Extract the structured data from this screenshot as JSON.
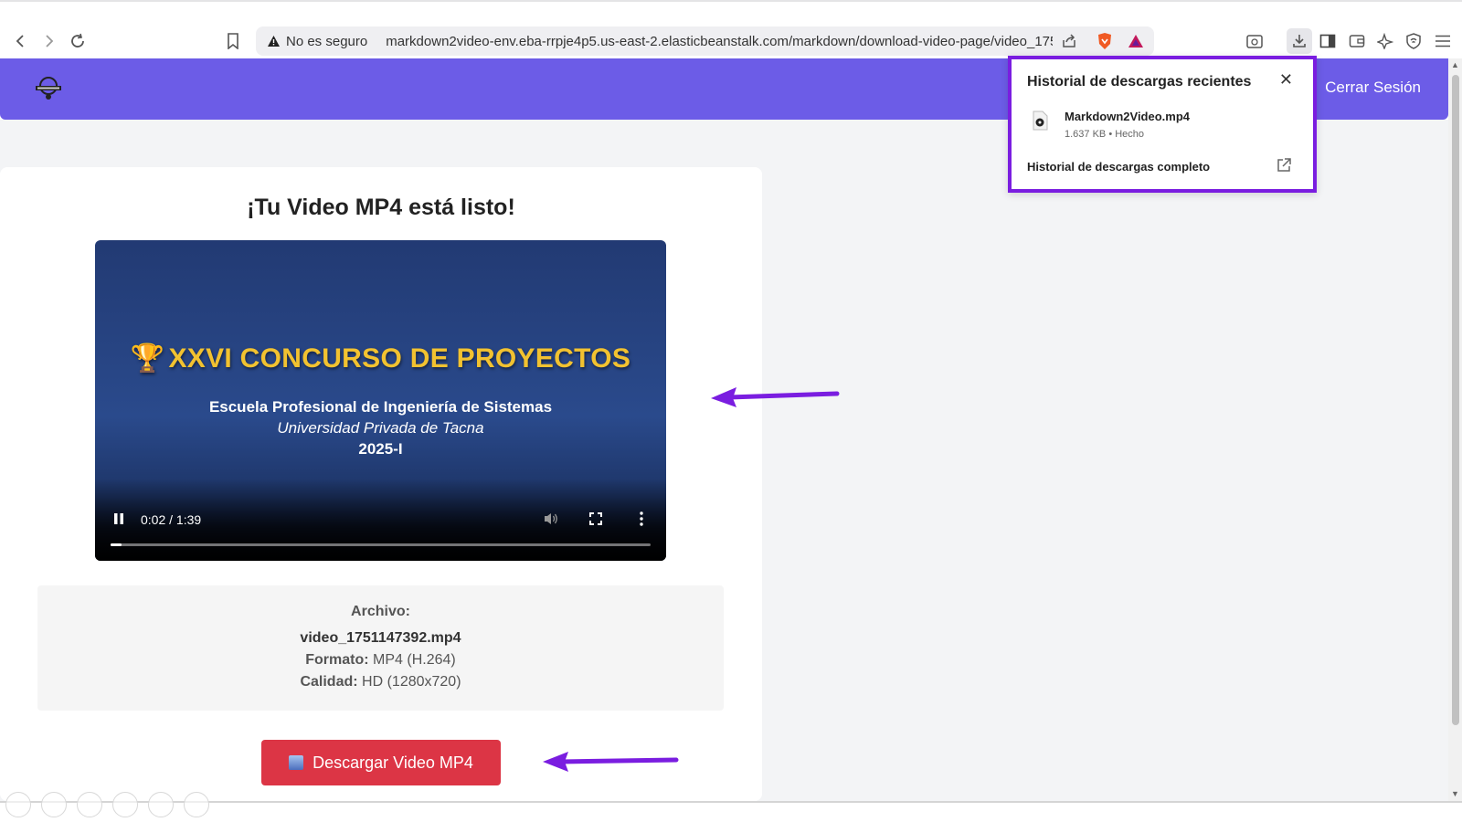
{
  "browser": {
    "security_label": "No es seguro",
    "url": "markdown2video-env.eba-rrpje4p5.us-east-2.elasticbeanstalk.com/markdown/download-video-page/video_175..."
  },
  "header": {
    "logout_label": "Cerrar Sesión",
    "brand_color": "#6c5ce7"
  },
  "main": {
    "title": "¡Tu Video MP4 está listo!",
    "video": {
      "heading_emoji": "🏆",
      "heading": "XXVI CONCURSO DE PROYECTOS",
      "line1": "Escuela Profesional de Ingeniería de Sistemas",
      "line2": "Universidad Privada de Tacna",
      "line3": "2025-I",
      "time_display": "0:02 / 1:39",
      "progress_fraction": 0.02
    },
    "info": {
      "file_label": "Archivo:",
      "file_name": "video_1751147392.mp4",
      "format_label": "Formato:",
      "format_value": "MP4 (H.264)",
      "quality_label": "Calidad:",
      "quality_value": "HD (1280x720)"
    },
    "download_button": "Descargar Video MP4",
    "download_button_color": "#dc3545"
  },
  "downloads_popup": {
    "title": "Historial de descargas recientes",
    "file_name": "Markdown2Video.mp4",
    "file_meta": "1.637 KB • Hecho",
    "full_history": "Historial de descargas completo",
    "highlight_color": "#7a1de0"
  },
  "annotations": {
    "arrow_color": "#7a1de0"
  }
}
